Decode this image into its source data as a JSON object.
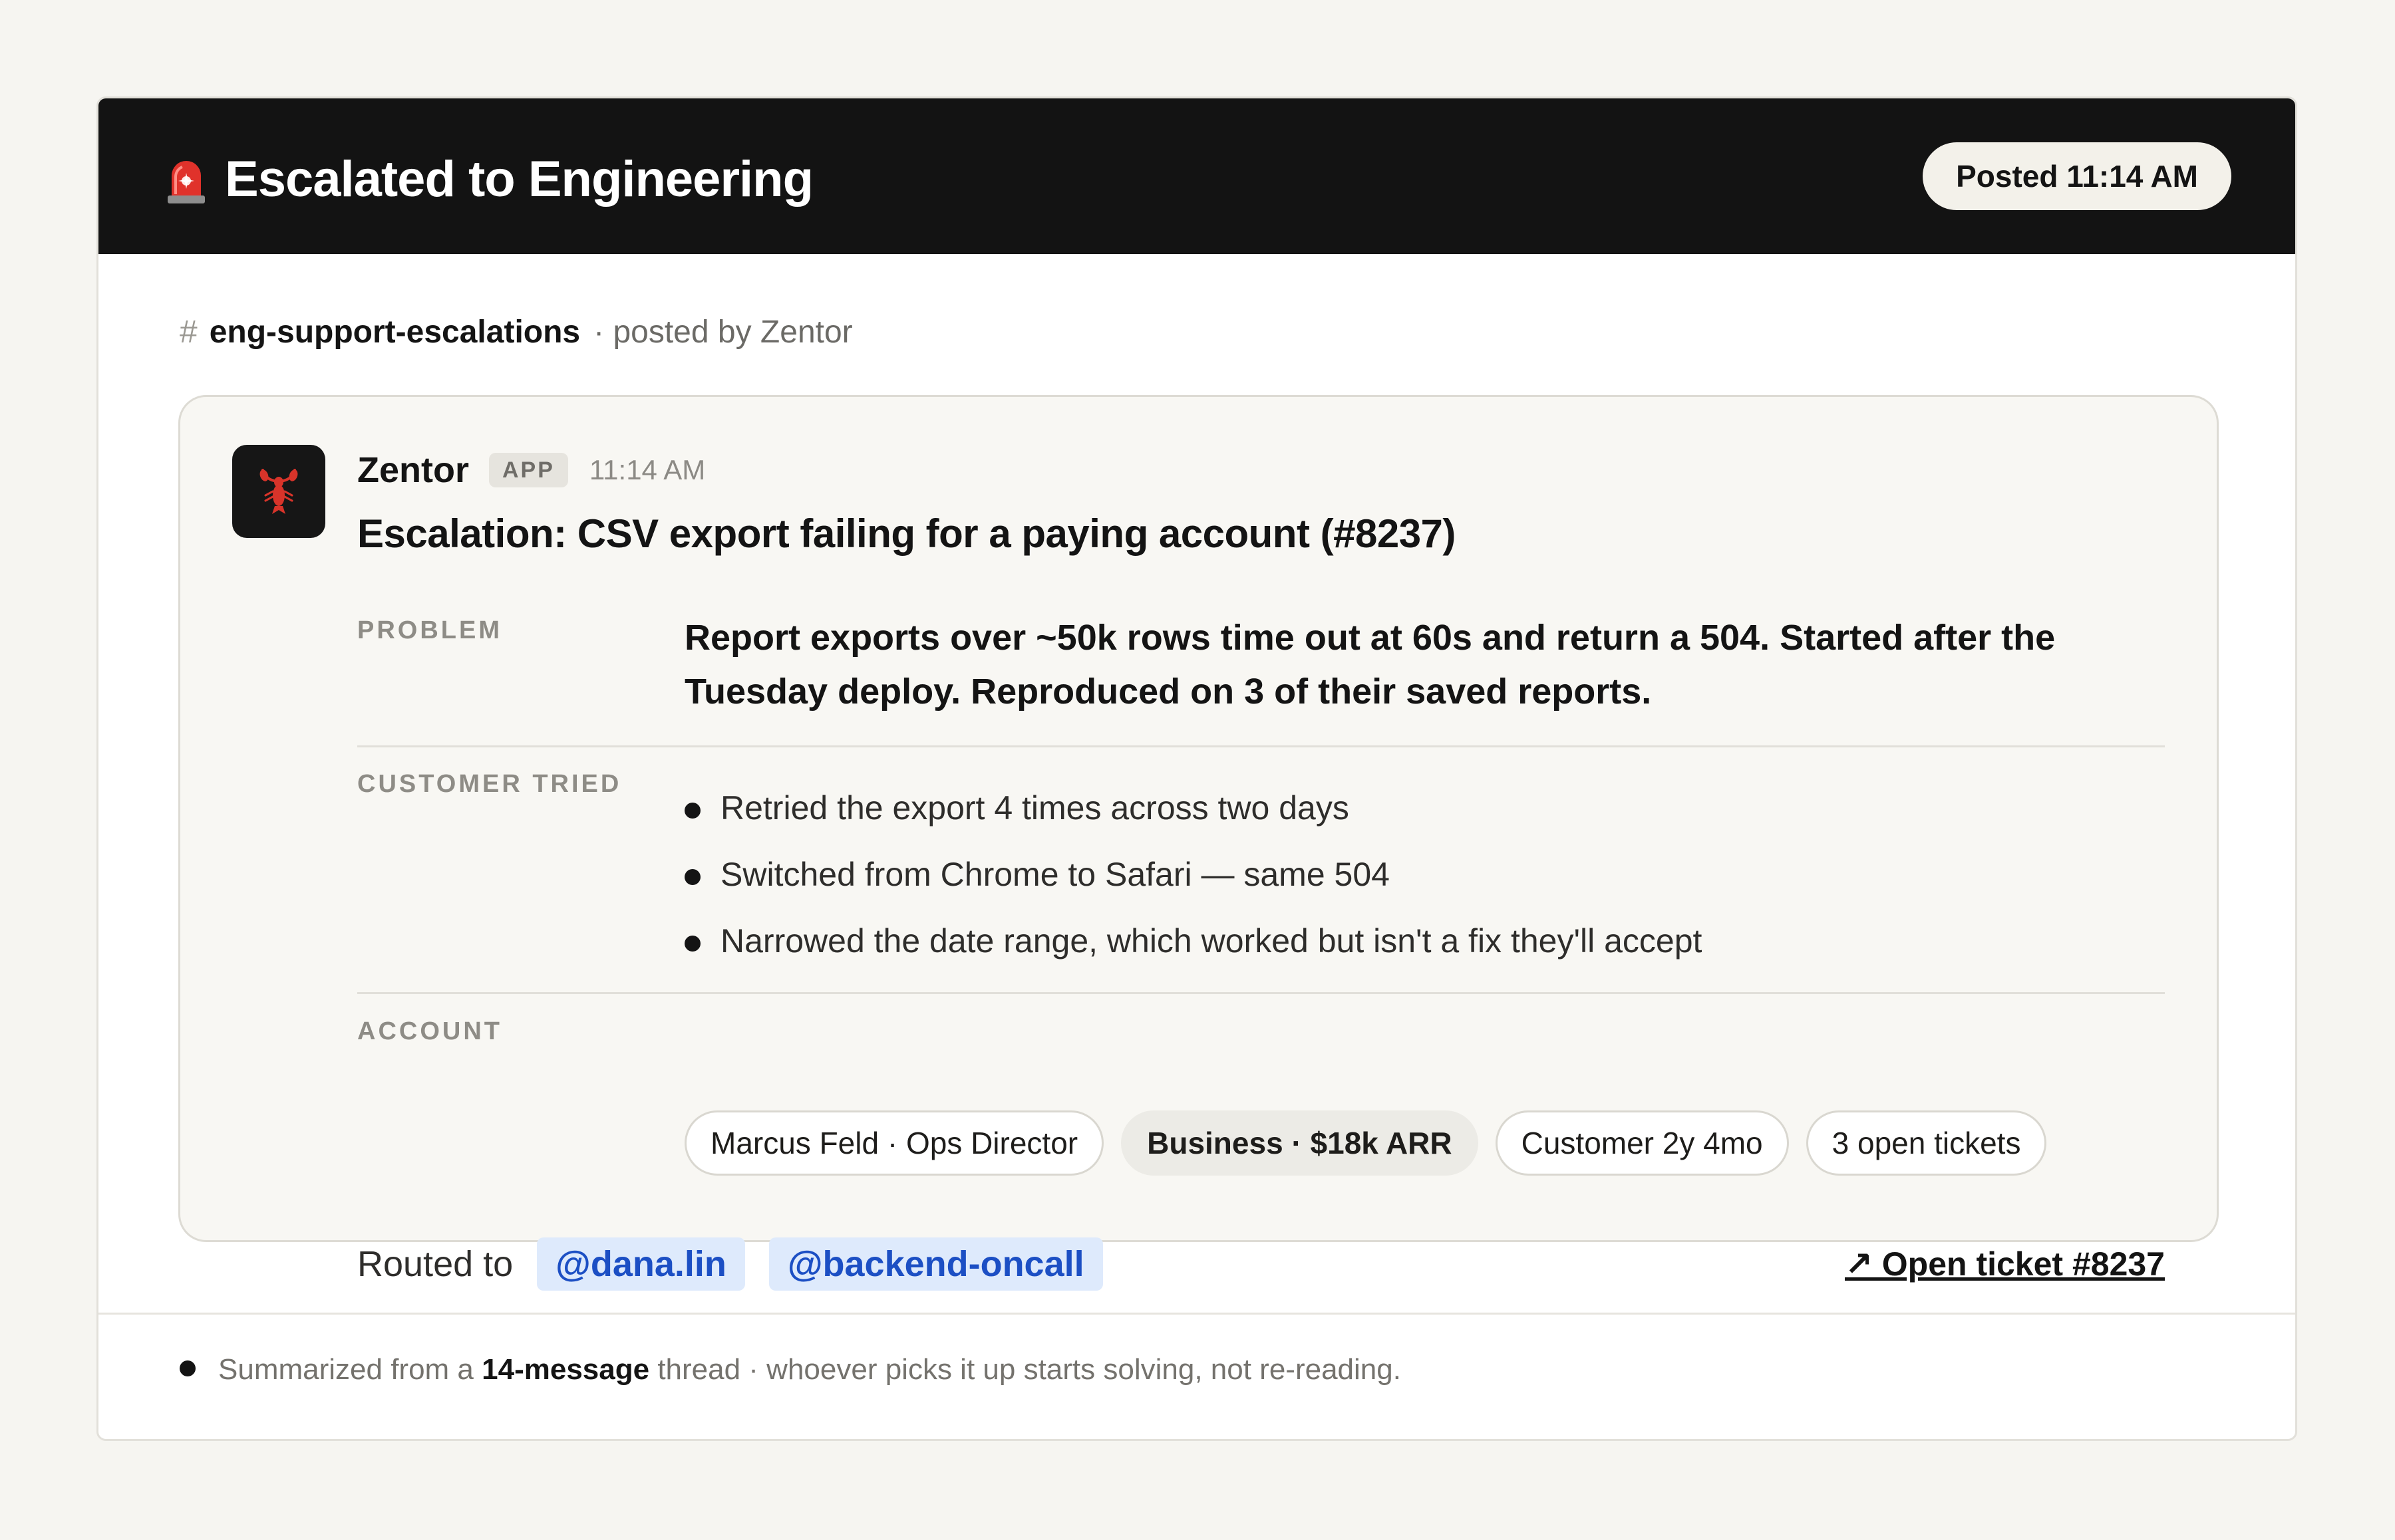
{
  "header": {
    "icon": "siren-icon",
    "title": "Escalated to Engineering",
    "posted_pill": "Posted 11:14 AM"
  },
  "channel": {
    "hash": "#",
    "name": "eng-support-escalations",
    "posted_by": "· posted by Zentor"
  },
  "message": {
    "avatar_icon": "lobster-icon",
    "sender": "Zentor",
    "badge": "APP",
    "time": "11:14 AM",
    "subject": "Escalation: CSV export failing for a paying account (#8237)",
    "problem": {
      "label": "PROBLEM",
      "text": "Report exports over ~50k rows time out at 60s and return a 504. Started after the Tuesday deploy. Reproduced on 3 of their saved reports."
    },
    "customer_tried": {
      "label": "CUSTOMER TRIED",
      "items": [
        "Retried the export 4 times across two days",
        "Switched from Chrome to Safari — same 504",
        "Narrowed the date range, which worked but isn't a fix they'll accept"
      ]
    },
    "account": {
      "label": "ACCOUNT",
      "chips": [
        "Marcus Feld · Ops Director",
        "Business · $18k ARR",
        "Customer 2y 4mo",
        "3 open tickets"
      ]
    },
    "routing": {
      "label": "Routed to",
      "mentions": [
        "@dana.lin",
        "@backend-oncall"
      ]
    },
    "open_ticket": "↗ Open ticket #8237"
  },
  "footer": {
    "prefix": "Summarized from a",
    "count": "14-message",
    "suffix": "thread · whoever picks it up starts solving, not re-reading."
  },
  "colors": {
    "header_bg": "#131313",
    "page_bg": "#f6f5f1",
    "mention_bg": "#deeafc",
    "mention_text": "#1c4fc4",
    "siren_red": "#e0322b"
  }
}
